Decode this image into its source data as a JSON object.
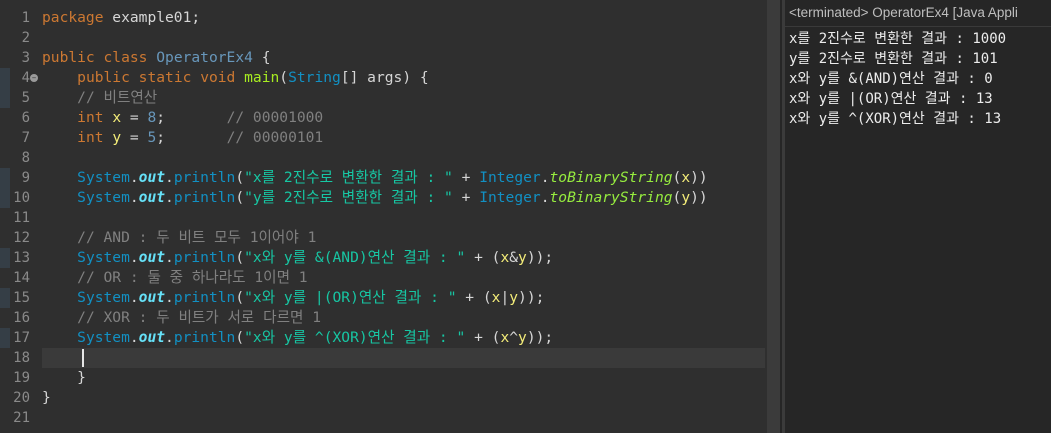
{
  "editor": {
    "lines": [
      {
        "n": "1",
        "tokens": [
          {
            "c": "kw",
            "t": "package"
          },
          {
            "c": "pl",
            "t": " example01;"
          }
        ]
      },
      {
        "n": "2",
        "tokens": []
      },
      {
        "n": "3",
        "tokens": [
          {
            "c": "kw",
            "t": "public"
          },
          {
            "c": "pl",
            "t": " "
          },
          {
            "c": "kw",
            "t": "class"
          },
          {
            "c": "pl",
            "t": " "
          },
          {
            "c": "cls",
            "t": "OperatorEx4"
          },
          {
            "c": "pl",
            "t": " {"
          }
        ]
      },
      {
        "n": "4",
        "tokens": [
          {
            "c": "pl",
            "t": "    "
          },
          {
            "c": "kw",
            "t": "public"
          },
          {
            "c": "pl",
            "t": " "
          },
          {
            "c": "kw",
            "t": "static"
          },
          {
            "c": "pl",
            "t": " "
          },
          {
            "c": "kw",
            "t": "void"
          },
          {
            "c": "pl",
            "t": " "
          },
          {
            "c": "meth",
            "t": "main"
          },
          {
            "c": "pl",
            "t": "("
          },
          {
            "c": "typ",
            "t": "String"
          },
          {
            "c": "pl",
            "t": "[] "
          },
          {
            "c": "pl",
            "t": "args) {"
          }
        ]
      },
      {
        "n": "5",
        "tokens": [
          {
            "c": "pl",
            "t": "    "
          },
          {
            "c": "cm",
            "t": "// 비트연산"
          }
        ]
      },
      {
        "n": "6",
        "tokens": [
          {
            "c": "pl",
            "t": "    "
          },
          {
            "c": "kw",
            "t": "int"
          },
          {
            "c": "pl",
            "t": " "
          },
          {
            "c": "var",
            "t": "x"
          },
          {
            "c": "pl",
            "t": " = "
          },
          {
            "c": "num",
            "t": "8"
          },
          {
            "c": "pl",
            "t": ";       "
          },
          {
            "c": "cm",
            "t": "// 00001000"
          }
        ]
      },
      {
        "n": "7",
        "tokens": [
          {
            "c": "pl",
            "t": "    "
          },
          {
            "c": "kw",
            "t": "int"
          },
          {
            "c": "pl",
            "t": " "
          },
          {
            "c": "var",
            "t": "y"
          },
          {
            "c": "pl",
            "t": " = "
          },
          {
            "c": "num",
            "t": "5"
          },
          {
            "c": "pl",
            "t": ";       "
          },
          {
            "c": "cm",
            "t": "// 00000101"
          }
        ]
      },
      {
        "n": "8",
        "tokens": []
      },
      {
        "n": "9",
        "tokens": [
          {
            "c": "pl",
            "t": "    "
          },
          {
            "c": "typ",
            "t": "System"
          },
          {
            "c": "pl",
            "t": "."
          },
          {
            "c": "fld",
            "t": "out"
          },
          {
            "c": "pl",
            "t": "."
          },
          {
            "c": "typ",
            "t": "println"
          },
          {
            "c": "pl",
            "t": "("
          },
          {
            "c": "str",
            "t": "\"x를 2진수로 변환한 결과 : \""
          },
          {
            "c": "pl",
            "t": " + "
          },
          {
            "c": "typ",
            "t": "Integer"
          },
          {
            "c": "pl",
            "t": "."
          },
          {
            "c": "sta",
            "t": "toBinaryString"
          },
          {
            "c": "pl",
            "t": "("
          },
          {
            "c": "var",
            "t": "x"
          },
          {
            "c": "pl",
            "t": "))"
          }
        ]
      },
      {
        "n": "10",
        "tokens": [
          {
            "c": "pl",
            "t": "    "
          },
          {
            "c": "typ",
            "t": "System"
          },
          {
            "c": "pl",
            "t": "."
          },
          {
            "c": "fld",
            "t": "out"
          },
          {
            "c": "pl",
            "t": "."
          },
          {
            "c": "typ",
            "t": "println"
          },
          {
            "c": "pl",
            "t": "("
          },
          {
            "c": "str",
            "t": "\"y를 2진수로 변환한 결과 : \""
          },
          {
            "c": "pl",
            "t": " + "
          },
          {
            "c": "typ",
            "t": "Integer"
          },
          {
            "c": "pl",
            "t": "."
          },
          {
            "c": "sta",
            "t": "toBinaryString"
          },
          {
            "c": "pl",
            "t": "("
          },
          {
            "c": "var",
            "t": "y"
          },
          {
            "c": "pl",
            "t": "))"
          }
        ]
      },
      {
        "n": "11",
        "tokens": []
      },
      {
        "n": "12",
        "tokens": [
          {
            "c": "pl",
            "t": "    "
          },
          {
            "c": "cm",
            "t": "// AND : 두 비트 모두 1이어야 1"
          }
        ]
      },
      {
        "n": "13",
        "tokens": [
          {
            "c": "pl",
            "t": "    "
          },
          {
            "c": "typ",
            "t": "System"
          },
          {
            "c": "pl",
            "t": "."
          },
          {
            "c": "fld",
            "t": "out"
          },
          {
            "c": "pl",
            "t": "."
          },
          {
            "c": "typ",
            "t": "println"
          },
          {
            "c": "pl",
            "t": "("
          },
          {
            "c": "str",
            "t": "\"x와 y를 &(AND)연산 결과 : \""
          },
          {
            "c": "pl",
            "t": " + ("
          },
          {
            "c": "var",
            "t": "x"
          },
          {
            "c": "pl",
            "t": "&"
          },
          {
            "c": "var",
            "t": "y"
          },
          {
            "c": "pl",
            "t": "));"
          }
        ]
      },
      {
        "n": "14",
        "tokens": [
          {
            "c": "pl",
            "t": "    "
          },
          {
            "c": "cm",
            "t": "// OR : 둘 중 하나라도 1이면 1"
          }
        ]
      },
      {
        "n": "15",
        "tokens": [
          {
            "c": "pl",
            "t": "    "
          },
          {
            "c": "typ",
            "t": "System"
          },
          {
            "c": "pl",
            "t": "."
          },
          {
            "c": "fld",
            "t": "out"
          },
          {
            "c": "pl",
            "t": "."
          },
          {
            "c": "typ",
            "t": "println"
          },
          {
            "c": "pl",
            "t": "("
          },
          {
            "c": "str",
            "t": "\"x와 y를 |(OR)연산 결과 : \""
          },
          {
            "c": "pl",
            "t": " + ("
          },
          {
            "c": "var",
            "t": "x"
          },
          {
            "c": "pl",
            "t": "|"
          },
          {
            "c": "var",
            "t": "y"
          },
          {
            "c": "pl",
            "t": "));"
          }
        ]
      },
      {
        "n": "16",
        "tokens": [
          {
            "c": "pl",
            "t": "    "
          },
          {
            "c": "cm",
            "t": "// XOR : 두 비트가 서로 다르면 1"
          }
        ]
      },
      {
        "n": "17",
        "tokens": [
          {
            "c": "pl",
            "t": "    "
          },
          {
            "c": "typ",
            "t": "System"
          },
          {
            "c": "pl",
            "t": "."
          },
          {
            "c": "fld",
            "t": "out"
          },
          {
            "c": "pl",
            "t": "."
          },
          {
            "c": "typ",
            "t": "println"
          },
          {
            "c": "pl",
            "t": "("
          },
          {
            "c": "str",
            "t": "\"x와 y를 ^(XOR)연산 결과 : \""
          },
          {
            "c": "pl",
            "t": " + ("
          },
          {
            "c": "var",
            "t": "x"
          },
          {
            "c": "pl",
            "t": "^"
          },
          {
            "c": "var",
            "t": "y"
          },
          {
            "c": "pl",
            "t": "));"
          }
        ]
      },
      {
        "n": "18",
        "tokens": []
      },
      {
        "n": "19",
        "tokens": [
          {
            "c": "pl",
            "t": "    }"
          }
        ]
      },
      {
        "n": "20",
        "tokens": [
          {
            "c": "pl",
            "t": "}"
          }
        ]
      },
      {
        "n": "21",
        "tokens": []
      }
    ],
    "current_line": 18
  },
  "console": {
    "header": "<terminated> OperatorEx4 [Java Appli",
    "output": [
      "x를 2진수로 변환한 결과 : 1000",
      "y를 2진수로 변환한 결과 : 101",
      "x와 y를 &(AND)연산 결과 : 0",
      "x와 y를 |(OR)연산 결과 : 13",
      "x와 y를 ^(XOR)연산 결과 : 13"
    ]
  }
}
